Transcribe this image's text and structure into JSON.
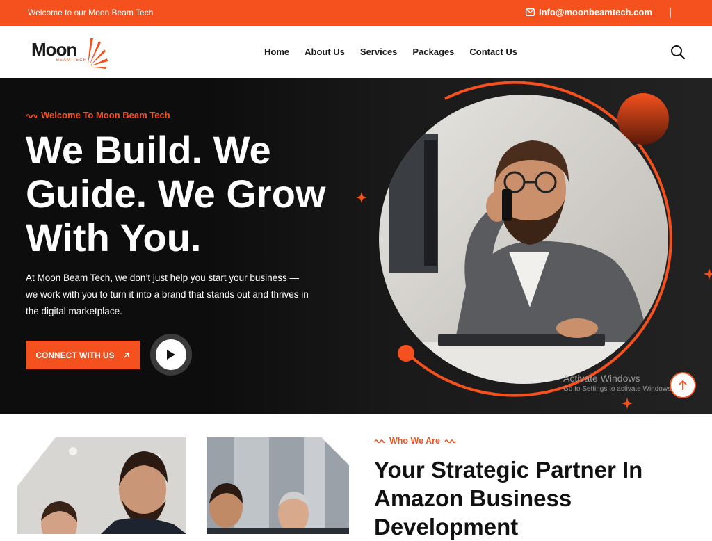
{
  "topbar": {
    "welcome": "Welcome to our Moon Beam Tech",
    "email": "Info@moonbeamtech.com"
  },
  "logo": {
    "word": "Moon",
    "sub": "BEAM TECH"
  },
  "nav": {
    "items": [
      {
        "label": "Home"
      },
      {
        "label": "About Us"
      },
      {
        "label": "Services"
      },
      {
        "label": "Packages"
      },
      {
        "label": "Contact Us"
      }
    ]
  },
  "hero": {
    "tag": "Welcome To Moon Beam Tech",
    "title": "We Build. We Guide. We Grow With You.",
    "description": "At Moon Beam Tech, we don’t just help you start your business — we work with you to turn it into a brand that stands out and thrives in the digital marketplace.",
    "cta_label": "CONNECT WITH US"
  },
  "os_overlay": {
    "line1": "Activate Windows",
    "line2": "Go to Settings to activate Windows."
  },
  "about": {
    "tag": "Who We Are",
    "title": "Your Strategic Partner In Amazon Business Development"
  },
  "colors": {
    "accent": "#f4511e",
    "dark": "#0d0d0d"
  },
  "icons": [
    "mail-icon",
    "search-icon",
    "arrow-up-right-icon",
    "play-icon",
    "arrow-up-icon",
    "squiggle-icon",
    "sparkle-icon"
  ]
}
